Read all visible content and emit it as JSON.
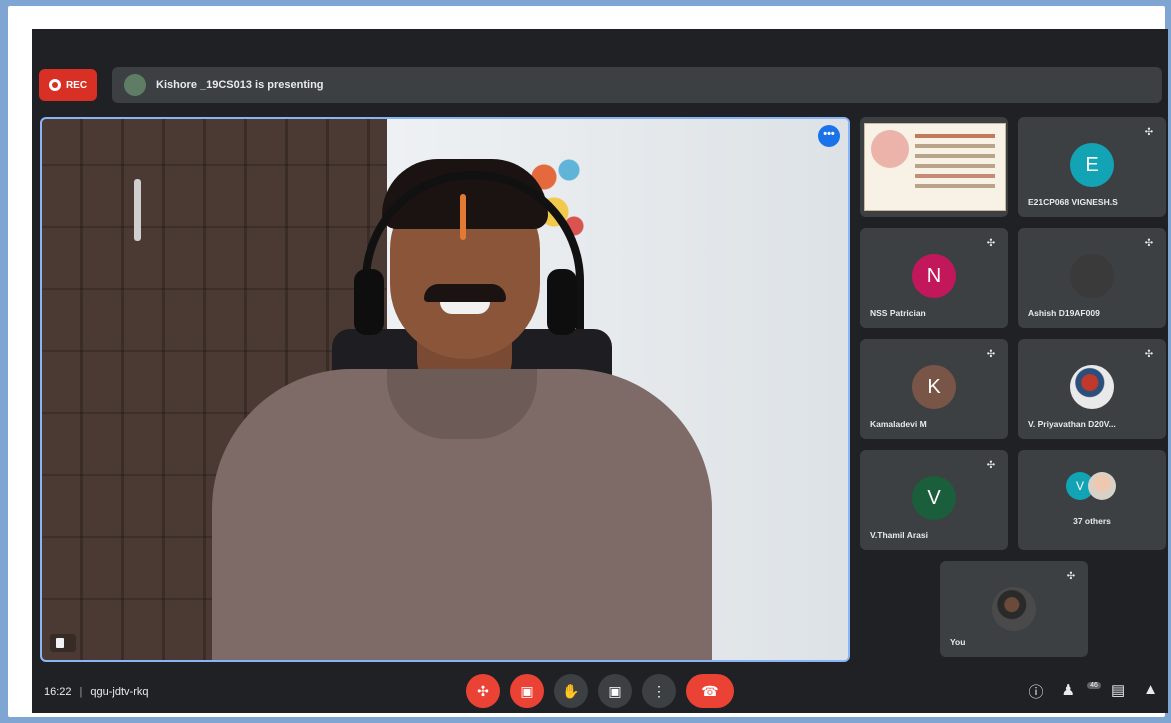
{
  "recording": {
    "label": "REC"
  },
  "presenting_banner": {
    "text": "Kishore _19CS013 is presenting",
    "avatar_initial": ""
  },
  "main_video": {
    "more_options_icon": "more-horiz-icon",
    "more_label": "•••",
    "name_tag": ""
  },
  "participants": [
    {
      "name": "",
      "type": "screen-share-thumbnail"
    },
    {
      "name": "E21CP068 VIGNESH.S",
      "initial": "E",
      "color": "#12a4b5",
      "muted": true
    },
    {
      "name": "NSS Patrician",
      "initial": "N",
      "color": "#c2185b",
      "muted": true
    },
    {
      "name": "Ashish D19AF009",
      "initial": "",
      "color": "#3a3a3a",
      "muted": true
    },
    {
      "name": "Kamaladevi M",
      "initial": "K",
      "color": "#795548",
      "muted": true
    },
    {
      "name": "V. Priyavathan D20V...",
      "initial": "",
      "color": "#e9e9e9",
      "muted": true
    },
    {
      "name": "V.Thamil Arasi",
      "initial": "V",
      "color": "#1b5e3b",
      "muted": true
    },
    {
      "name": "37 others",
      "initial": "V"
    },
    {
      "name": "You",
      "muted": true
    }
  ],
  "bottom_bar": {
    "time": "16:22",
    "separator": "|",
    "meeting_code": "qgu-jdtv-rkq",
    "controls": {
      "mic": "mic-off-icon",
      "camera": "camera-off-icon",
      "raise_hand": "hand-icon",
      "present": "present-screen-icon",
      "more": "more-vert-icon",
      "leave": "call-end-icon"
    },
    "people_count": "46"
  },
  "colors": {
    "background": "#202124",
    "tile": "#3c4043",
    "accent": "#8ab4f8",
    "danger": "#ea4335"
  }
}
